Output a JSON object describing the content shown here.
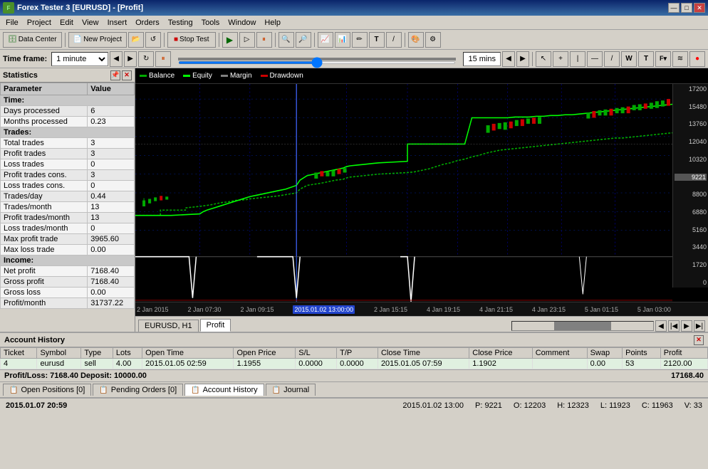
{
  "titleBar": {
    "title": "Forex Tester 3 [EURUSD] - [Profit]",
    "minBtn": "—",
    "maxBtn": "□",
    "closeBtn": "✕"
  },
  "menuBar": {
    "items": [
      "File",
      "Project",
      "Edit",
      "View",
      "Insert",
      "Orders",
      "Testing",
      "Tools",
      "Window",
      "Help"
    ]
  },
  "toolbar": {
    "dataCenterBtn": "Data Center",
    "newProjectBtn": "New Project",
    "stopTestBtn": "Stop Test",
    "timeframeLabel": "Time frame:",
    "timeframeValue": "1 minute",
    "timer": "15 mins"
  },
  "statistics": {
    "title": "Statistics",
    "headers": [
      "Parameter",
      "Value"
    ],
    "sections": [
      {
        "type": "section",
        "label": "Time:"
      },
      {
        "type": "row",
        "param": "Days processed",
        "value": "6"
      },
      {
        "type": "row",
        "param": "Months processed",
        "value": "0.23"
      },
      {
        "type": "section",
        "label": "Trades:"
      },
      {
        "type": "row",
        "param": "Total trades",
        "value": "3"
      },
      {
        "type": "row",
        "param": "Profit trades",
        "value": "3"
      },
      {
        "type": "row",
        "param": "Loss trades",
        "value": "0"
      },
      {
        "type": "row",
        "param": "Profit trades cons.",
        "value": "3"
      },
      {
        "type": "row",
        "param": "Loss trades cons.",
        "value": "0"
      },
      {
        "type": "row",
        "param": "Trades/day",
        "value": "0.44"
      },
      {
        "type": "row",
        "param": "Trades/month",
        "value": "13"
      },
      {
        "type": "row",
        "param": "Profit trades/month",
        "value": "13"
      },
      {
        "type": "row",
        "param": "Loss trades/month",
        "value": "0"
      },
      {
        "type": "row",
        "param": "Max profit trade",
        "value": "3965.60"
      },
      {
        "type": "row",
        "param": "Max loss trade",
        "value": "0.00"
      },
      {
        "type": "section",
        "label": "Income:"
      },
      {
        "type": "row",
        "param": "Net profit",
        "value": "7168.40"
      },
      {
        "type": "row",
        "param": "Gross profit",
        "value": "7168.40"
      },
      {
        "type": "row",
        "param": "Gross loss",
        "value": "0.00"
      },
      {
        "type": "row",
        "param": "Profit/month",
        "value": "31737.22"
      }
    ]
  },
  "chartLegend": {
    "items": [
      {
        "name": "Balance",
        "color": "#00aa00"
      },
      {
        "name": "Equity",
        "color": "#00ff00"
      },
      {
        "name": "Margin",
        "color": "#808080"
      },
      {
        "name": "Drawdown",
        "color": "#cc0000"
      }
    ]
  },
  "chartYAxis": {
    "labels": [
      "17200",
      "15480",
      "13760",
      "12040",
      "10320",
      "9221",
      "8800",
      "6880",
      "5160",
      "3440",
      "1720",
      "0"
    ]
  },
  "chartXAxis": {
    "labels": [
      "2 Jan 2015",
      "2 Jan 07:30",
      "2 Jan 09:15",
      "2015.01.02 13:00:00",
      "2 Jan 15:15",
      "4 Jan 19:15",
      "4 Jan 21:15",
      "4 Jan 23:15",
      "5 Jan 01:15",
      "5 Jan 03:00"
    ]
  },
  "chartTabs": {
    "tabs": [
      "EURUSD, H1",
      "Profit"
    ],
    "activeTab": "Profit"
  },
  "accountHistory": {
    "title": "Account History",
    "columns": [
      "Ticket",
      "Symbol",
      "Type",
      "Lots",
      "Open Time",
      "Open Price",
      "S/L",
      "T/P",
      "Close Time",
      "Close Price",
      "Comment",
      "Swap",
      "Points",
      "Profit"
    ],
    "rows": [
      {
        "ticket": "4",
        "symbol": "eurusd",
        "type": "sell",
        "lots": "4.00",
        "openTime": "2015.01.05 02:59",
        "openPrice": "1.1955",
        "sl": "0.0000",
        "tp": "0.0000",
        "closeTime": "2015.01.05 07:59",
        "closePrice": "1.1902",
        "comment": "",
        "swap": "0.00",
        "points": "53",
        "profit": "2120.00"
      }
    ],
    "pnl": "Profit/Loss: 7168.40 Deposit: 10000.00",
    "totalBalance": "17168.40"
  },
  "bottomTabs": {
    "tabs": [
      "Open Positions [0]",
      "Pending Orders [0]",
      "Account History",
      "Journal"
    ]
  },
  "statusBar": {
    "datetime": "2015.01.07 20:59",
    "chartTime": "2015.01.02 13:00",
    "priceP": "9221",
    "priceO": "12203",
    "priceH": "12323",
    "priceL": "11923",
    "priceC": "11963",
    "volume": "33"
  }
}
